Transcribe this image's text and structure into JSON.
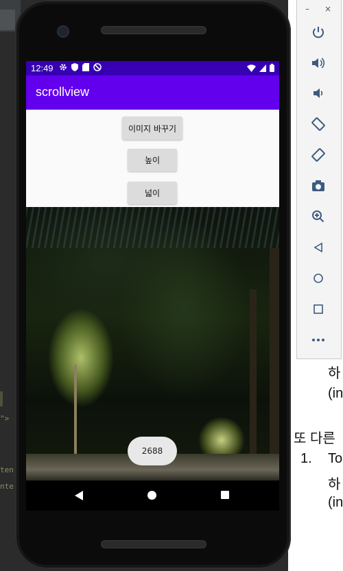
{
  "app": {
    "title": "scrollview",
    "status_time": "12:49"
  },
  "buttons": {
    "change_image": "이미지 바꾸기",
    "height": "높이",
    "width": "넓이"
  },
  "toast": {
    "text": "2688"
  },
  "emulator_toolbar": {
    "minimize": "–",
    "close": "×",
    "tools": [
      "power-icon",
      "volume-up-icon",
      "volume-down-icon",
      "rotate-left-icon",
      "rotate-right-icon",
      "camera-icon",
      "zoom-icon",
      "back-icon",
      "home-icon",
      "overview-icon",
      "more-icon"
    ]
  },
  "background_doc": {
    "line1": "하",
    "line2": "(in",
    "line3": "또 다른",
    "line4_num": "1.",
    "line4": "To",
    "line5": "하",
    "line6": "(in"
  },
  "background_code": {
    "frag1": "\">",
    "frag2": "ten",
    "frag3": "nte"
  },
  "colors": {
    "status_bar": "#3700b3",
    "app_bar": "#6200ee",
    "button": "#dcdcdc"
  }
}
